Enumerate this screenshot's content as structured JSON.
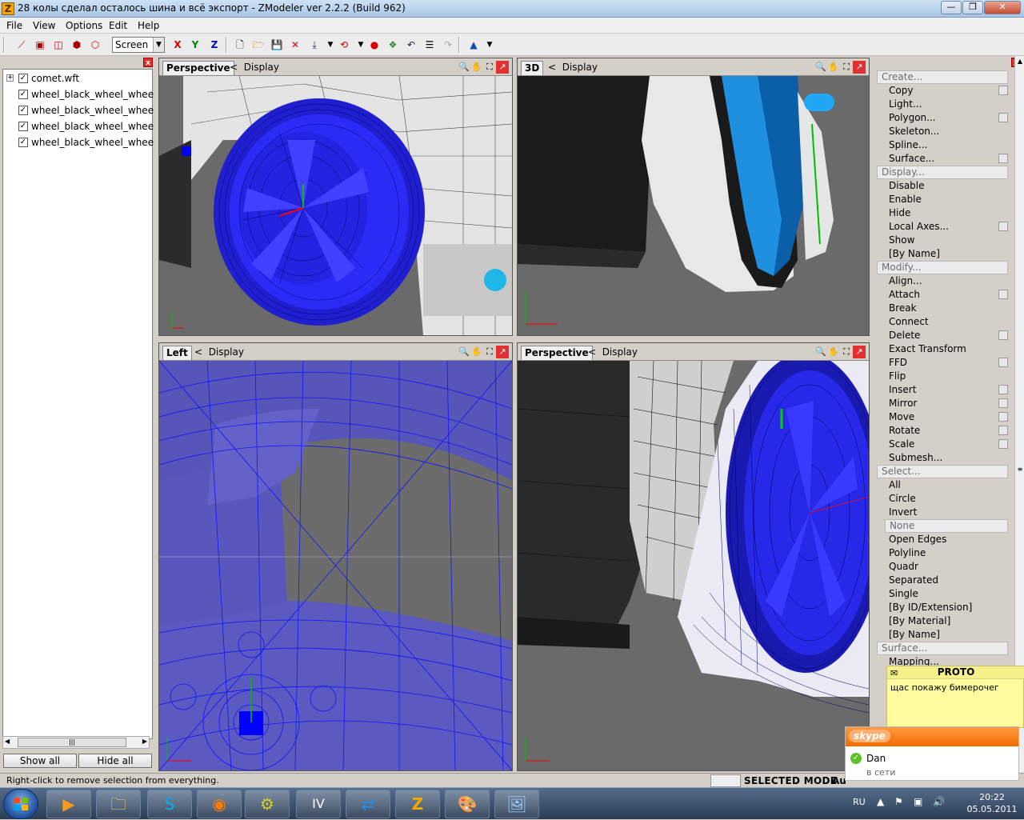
{
  "window": {
    "title": "28 колы сделал осталось шина и всё экспорт - ZModeler ver 2.2.2 (Build 962)",
    "app_icon": "Z",
    "buttons": {
      "minimize": "—",
      "restore": "❐",
      "close": "✕"
    }
  },
  "menu": [
    "File",
    "View",
    "Options",
    "Edit",
    "Help"
  ],
  "toolbar": {
    "coord_select": "Screen",
    "axis_x": "X",
    "axis_y": "Y",
    "axis_z": "Z"
  },
  "scene_tree": {
    "items": [
      {
        "label": "comet.wft",
        "checked": true,
        "expandable": true
      },
      {
        "label": "wheel_black_wheel_wheel_bl",
        "checked": true,
        "expandable": false
      },
      {
        "label": "wheel_black_wheel_wheel_bl",
        "checked": true,
        "expandable": false
      },
      {
        "label": "wheel_black_wheel_wheel_bl",
        "checked": true,
        "expandable": false
      },
      {
        "label": "wheel_black_wheel_wheel_bl",
        "checked": true,
        "expandable": false
      }
    ],
    "show_all": "Show all",
    "hide_all": "Hide all"
  },
  "viewports": [
    {
      "name": "Perspective",
      "display": "Display"
    },
    {
      "name": "3D",
      "display": "Display"
    },
    {
      "name": "Left",
      "display": "Display"
    },
    {
      "name": "Perspective",
      "display": "Display"
    }
  ],
  "commands": {
    "create_header": "Create...",
    "create": [
      "Copy",
      "Light...",
      "Polygon...",
      "Skeleton...",
      "Spline...",
      "Surface..."
    ],
    "display_header": "Display...",
    "display": [
      "Disable",
      "Enable",
      "Hide",
      "Local Axes...",
      "Show",
      "[By Name]"
    ],
    "modify_header": "Modify...",
    "modify": [
      "Align...",
      "Attach",
      "Break",
      "Connect",
      "Delete",
      "Exact Transform",
      "FFD",
      "Flip",
      "Insert",
      "Mirror",
      "Move",
      "Rotate",
      "Scale",
      "Submesh..."
    ],
    "select_header": "Select...",
    "select": [
      "All",
      "Circle",
      "Invert",
      "None",
      "Open Edges",
      "Polyline",
      "Quadr",
      "Separated",
      "Single",
      "[By ID/Extension]",
      "[By Material]",
      "[By Name]"
    ],
    "select_selected": "None",
    "surface_header": "Surface...",
    "surface": [
      "Mapping..."
    ]
  },
  "status": {
    "hint": "Right-click to remove selection from everything.",
    "mode": "SELECTED MODE",
    "mode_extra": "Au"
  },
  "notification_proto": {
    "title": "PROTO",
    "message": "щас покажу бимерочег"
  },
  "skype_popup": {
    "brand": "skype",
    "contact": "Dan",
    "status": "в сети"
  },
  "taskbar": {
    "language": "RU",
    "time": "20:22",
    "date": "05.05.2011"
  },
  "colors": {
    "wire_blue": "#1a1aff",
    "accent_cyan": "#1e90ff",
    "skype_orange": "#f26b00",
    "note_yellow": "#fffca0"
  }
}
